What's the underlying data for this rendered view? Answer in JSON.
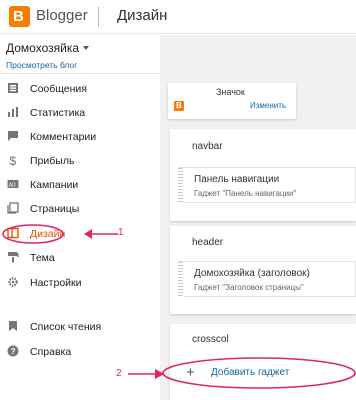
{
  "header": {
    "brand": "Blogger",
    "section_title": "Дизайн"
  },
  "blog": {
    "name": "Домохозяйка",
    "view_link": "Просмотреть блог"
  },
  "sidebar": {
    "items": [
      {
        "label": "Сообщения",
        "icon": "posts-icon"
      },
      {
        "label": "Статистика",
        "icon": "stats-icon"
      },
      {
        "label": "Комментарии",
        "icon": "comments-icon"
      },
      {
        "label": "Прибыль",
        "icon": "dollar-icon"
      },
      {
        "label": "Кампании",
        "icon": "ads-icon"
      },
      {
        "label": "Страницы",
        "icon": "pages-icon"
      },
      {
        "label": "Дизайн",
        "icon": "layout-icon",
        "active": true
      },
      {
        "label": "Тема",
        "icon": "theme-icon"
      },
      {
        "label": "Настройки",
        "icon": "settings-icon"
      },
      {
        "label": "Список чтения",
        "icon": "bookmark-icon"
      },
      {
        "label": "Справка",
        "icon": "help-icon"
      }
    ]
  },
  "layout": {
    "badge": {
      "title": "Значок",
      "edit": "Изменить"
    },
    "sections": [
      {
        "title": "navbar",
        "gadget_title": "Панель навигации",
        "gadget_sub": "Гаджет \"Панель навигации\""
      },
      {
        "title": "header",
        "gadget_title": "Домохозяйка (заголовок)",
        "gadget_sub": "Гаджет \"Заголовок страницы\""
      },
      {
        "title": "crosscol"
      }
    ],
    "add_gadget": "Добавить гаджет"
  },
  "annotations": {
    "one": "1",
    "two": "2"
  },
  "colors": {
    "brand": "#f57d00",
    "active": "#e65100",
    "link": "#1565a8",
    "annotation": "#e0246a"
  }
}
